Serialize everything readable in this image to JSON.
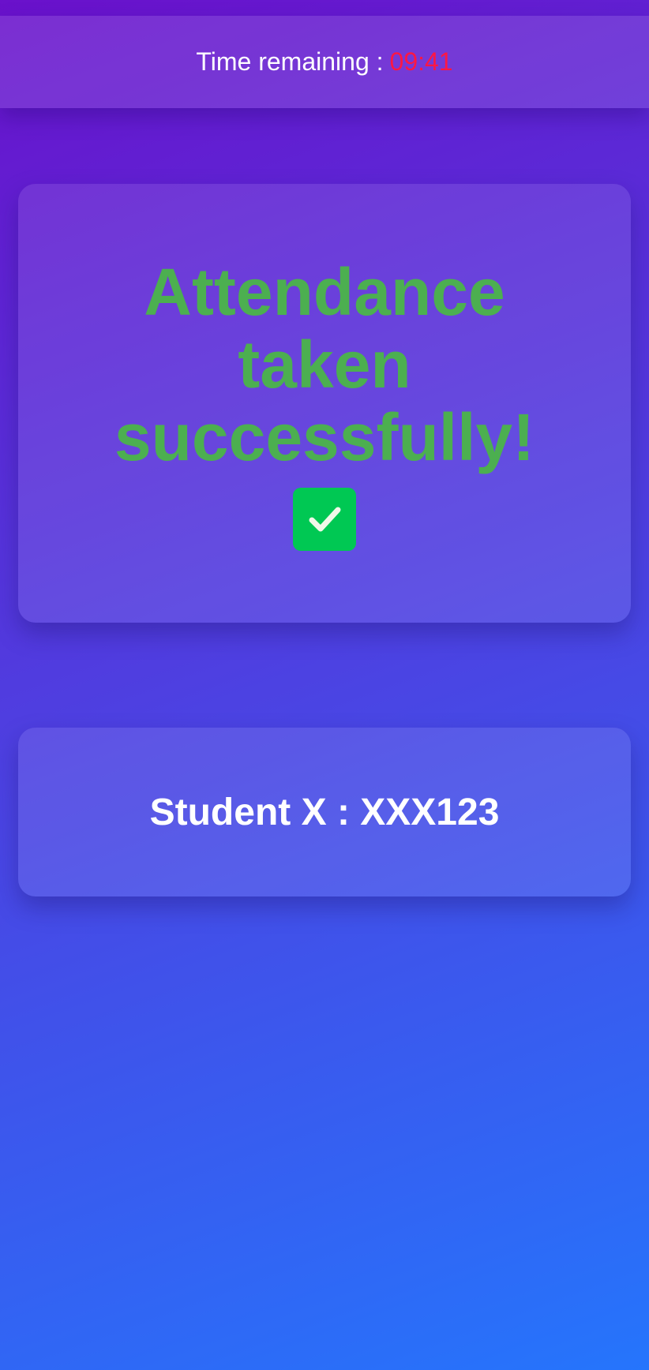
{
  "timer": {
    "label": "Time remaining :",
    "value": "09:41",
    "value_color": "#ff1744"
  },
  "confirmation": {
    "message": "Attendance taken successfully!",
    "message_color": "#4caf50",
    "icon": "check-square-icon",
    "icon_color": "#00c853"
  },
  "student": {
    "info": "Student X : XXX123"
  }
}
